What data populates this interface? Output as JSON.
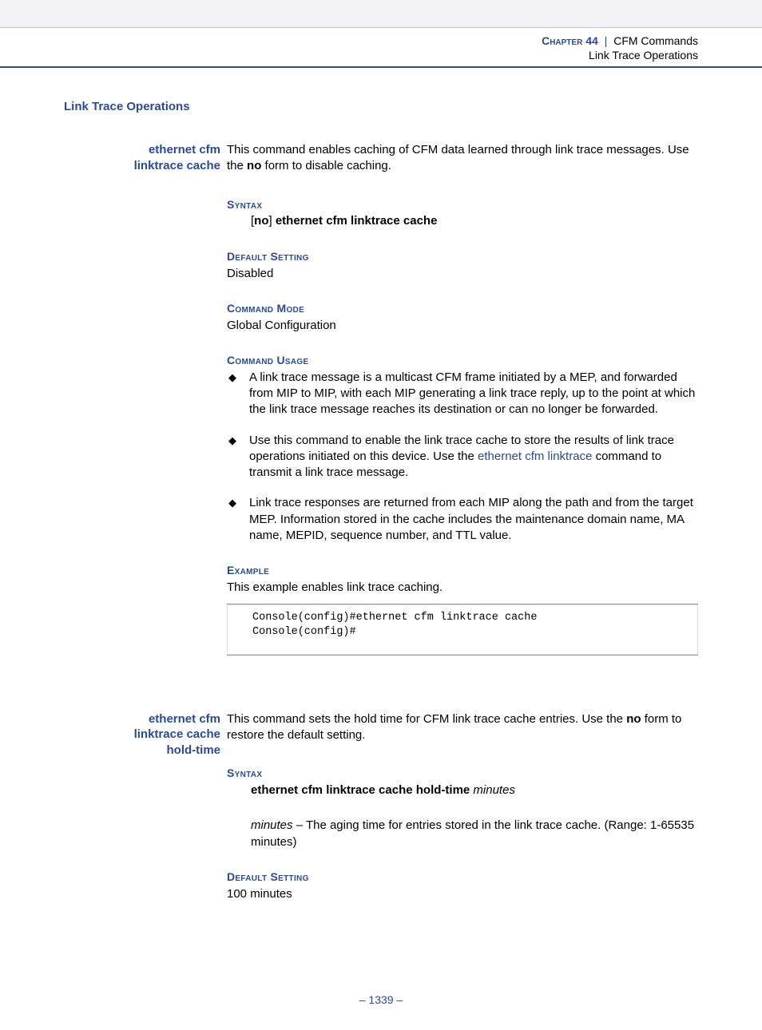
{
  "header": {
    "chapter_label": "Chapter",
    "chapter_num": "44",
    "separator": "|",
    "chapter_title": "CFM Commands",
    "subsection": "Link Trace Operations"
  },
  "section_title": "Link Trace Operations",
  "cmd1": {
    "name_line1": "ethernet cfm",
    "name_line2": "linktrace cache",
    "intro_part1": "This command enables caching of CFM data learned through link trace messages. Use the ",
    "intro_bold": "no",
    "intro_part2": " form to disable caching.",
    "syntax_head": "Syntax",
    "syntax_bracket1": "[",
    "syntax_no": "no",
    "syntax_bracket2": "] ",
    "syntax_cmd": "ethernet cfm linktrace cache",
    "default_head": "Default Setting",
    "default_val": "Disabled",
    "mode_head": "Command Mode",
    "mode_val": "Global Configuration",
    "usage_head": "Command Usage",
    "usage_b1": "A link trace message is a multicast CFM frame initiated by a MEP, and forwarded from MIP to MIP, with each MIP generating a link trace reply, up to the point at which the link trace message reaches its destination or can no longer be forwarded.",
    "usage_b2_a": "Use this command to enable the link trace cache to store the results of link trace operations initiated on this device. Use the ",
    "usage_b2_link": "ethernet cfm linktrace",
    "usage_b2_b": " command to transmit a link trace message.",
    "usage_b3": "Link trace responses are returned from each MIP along the path and from the target MEP. Information stored in the cache includes the maintenance domain name, MA name, MEPID, sequence number, and TTL value.",
    "example_head": "Example",
    "example_intro": "This example enables link trace caching.",
    "example_code": "Console(config)#ethernet cfm linktrace cache\nConsole(config)#"
  },
  "cmd2": {
    "name_line1": "ethernet cfm",
    "name_line2": "linktrace cache",
    "name_line3": "hold-time",
    "intro_part1": "This command sets the hold time for CFM link trace cache entries. Use the ",
    "intro_bold": "no",
    "intro_part2": " form to restore the default setting.",
    "syntax_head": "Syntax",
    "syntax_cmd": "ethernet cfm linktrace cache hold-time",
    "syntax_arg": " minutes",
    "param_name": "minutes",
    "param_desc": " – The aging time for entries stored in the link trace cache. (Range: 1-65535 minutes)",
    "default_head": "Default Setting",
    "default_val": "100 minutes"
  },
  "footer": {
    "dash1": "–  ",
    "page": "1339",
    "dash2": "  –"
  }
}
